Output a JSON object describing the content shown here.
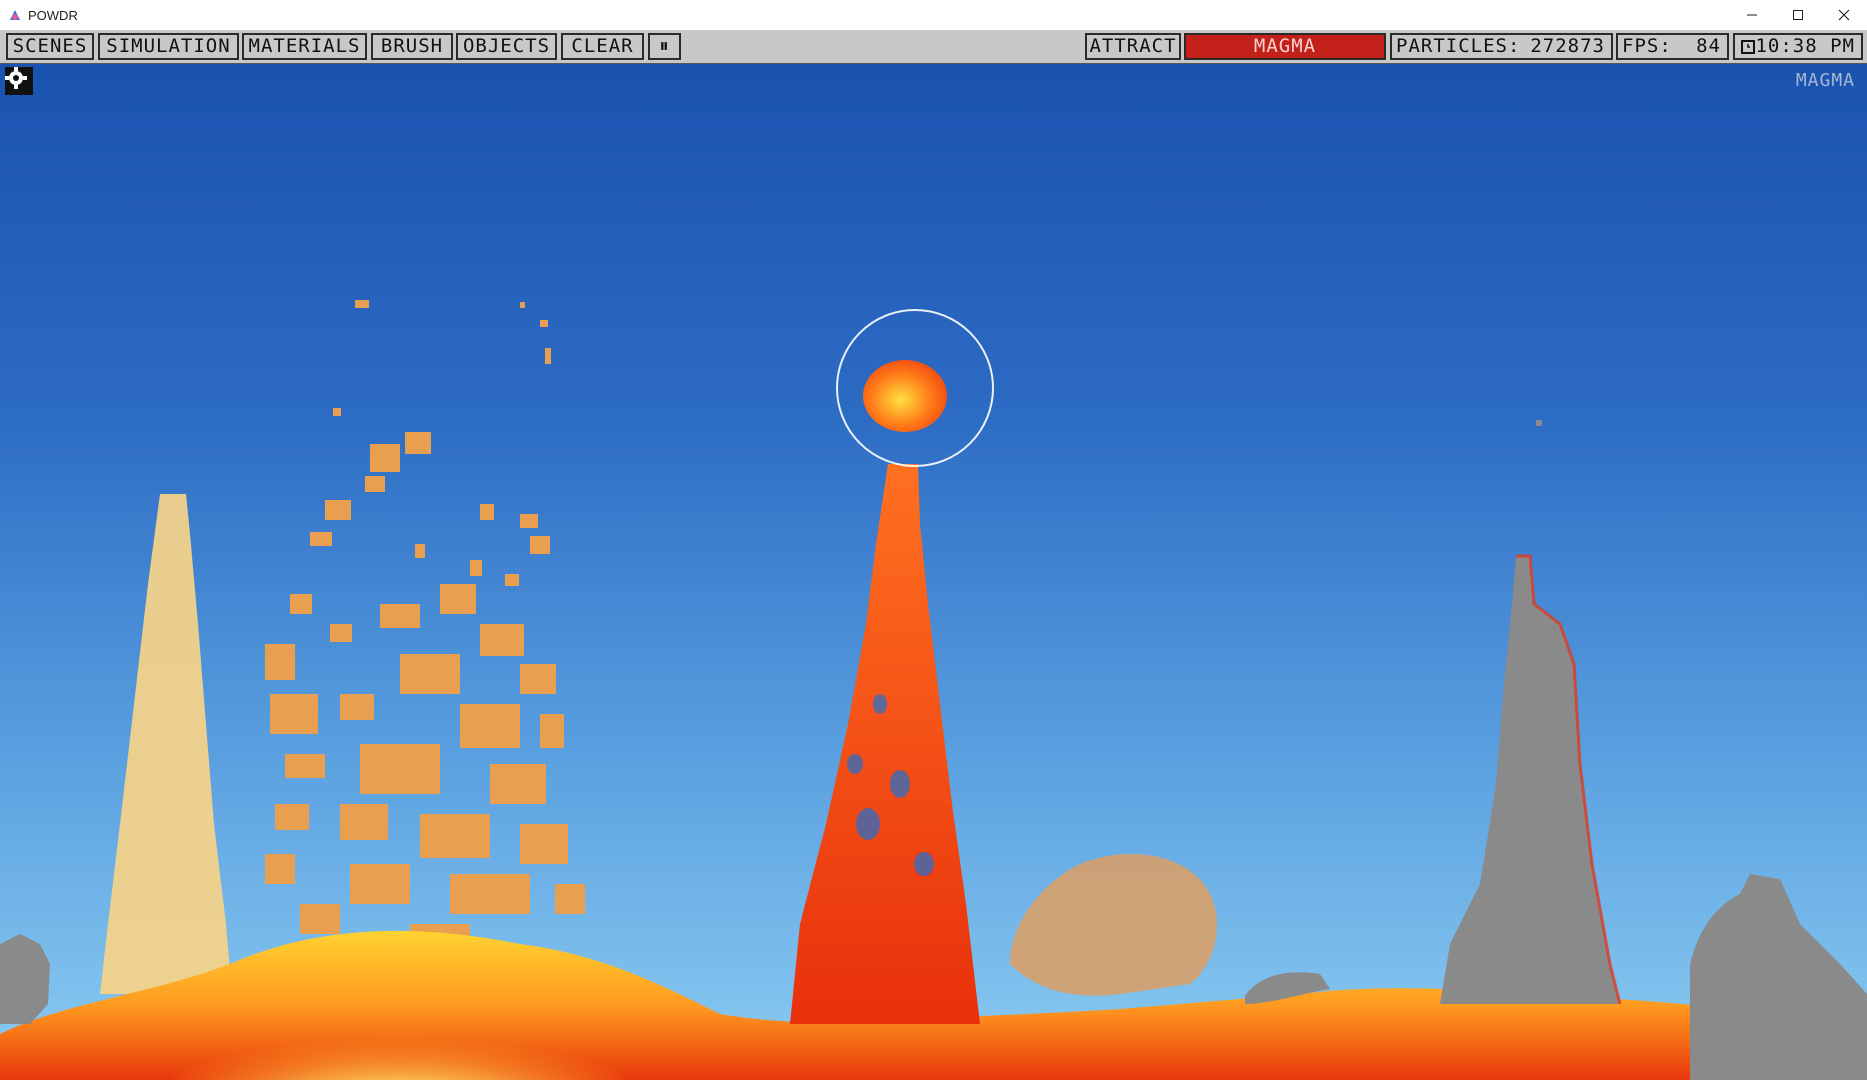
{
  "window": {
    "title": "POWDR"
  },
  "toolbar": {
    "menus": [
      "SCENES",
      "SIMULATION",
      "MATERIALS",
      "BRUSH",
      "OBJECTS",
      "CLEAR"
    ],
    "pause_label": "⏸",
    "mode": "ATTRACT",
    "material": "MAGMA",
    "particles_label": "PARTICLES:",
    "particles_value": "272873",
    "fps_label": "FPS:",
    "fps_value": "84",
    "time": "10:38 PM"
  },
  "game": {
    "material_overlay": "MAGMA"
  },
  "colors": {
    "toolbar_bg": "#c8c8c8",
    "material_accent": "#c4201a",
    "sky_top": "#1a52b0",
    "sky_bottom": "#8ccdf2",
    "magma": "#ff5a10",
    "sand": "#f2d28a",
    "powder": "#e8a050",
    "stone": "#8a8a8a"
  }
}
